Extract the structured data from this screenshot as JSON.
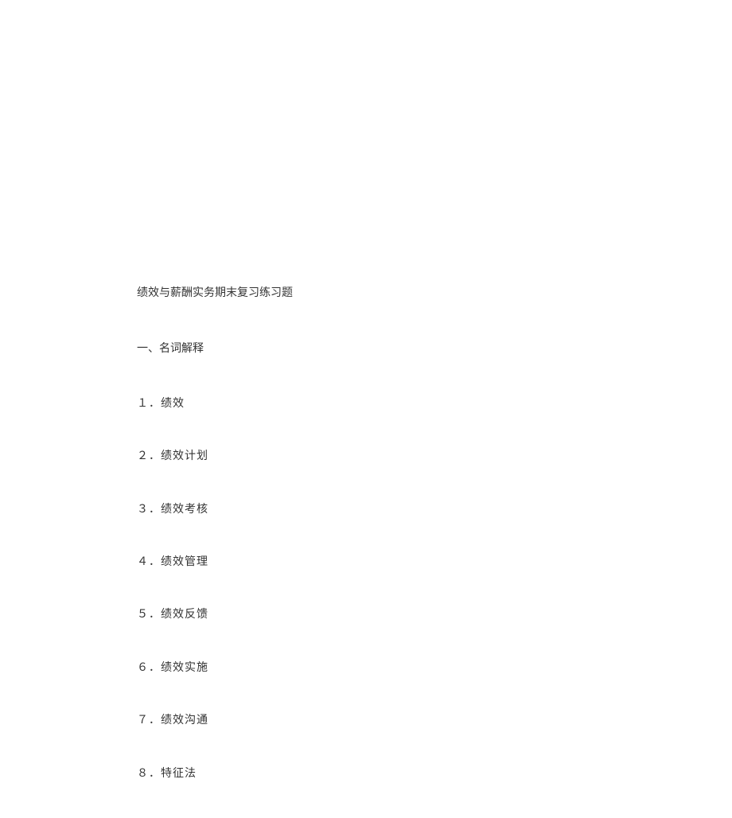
{
  "title": "绩效与薪酬实务期末复习练习题",
  "section_header": "一、名词解释",
  "items": [
    "１．绩效",
    "２．绩效计划",
    "３．绩效考核",
    "４．绩效管理",
    "５．绩效反馈",
    "６．绩效实施",
    "７．绩效沟通",
    "８．特征法"
  ]
}
